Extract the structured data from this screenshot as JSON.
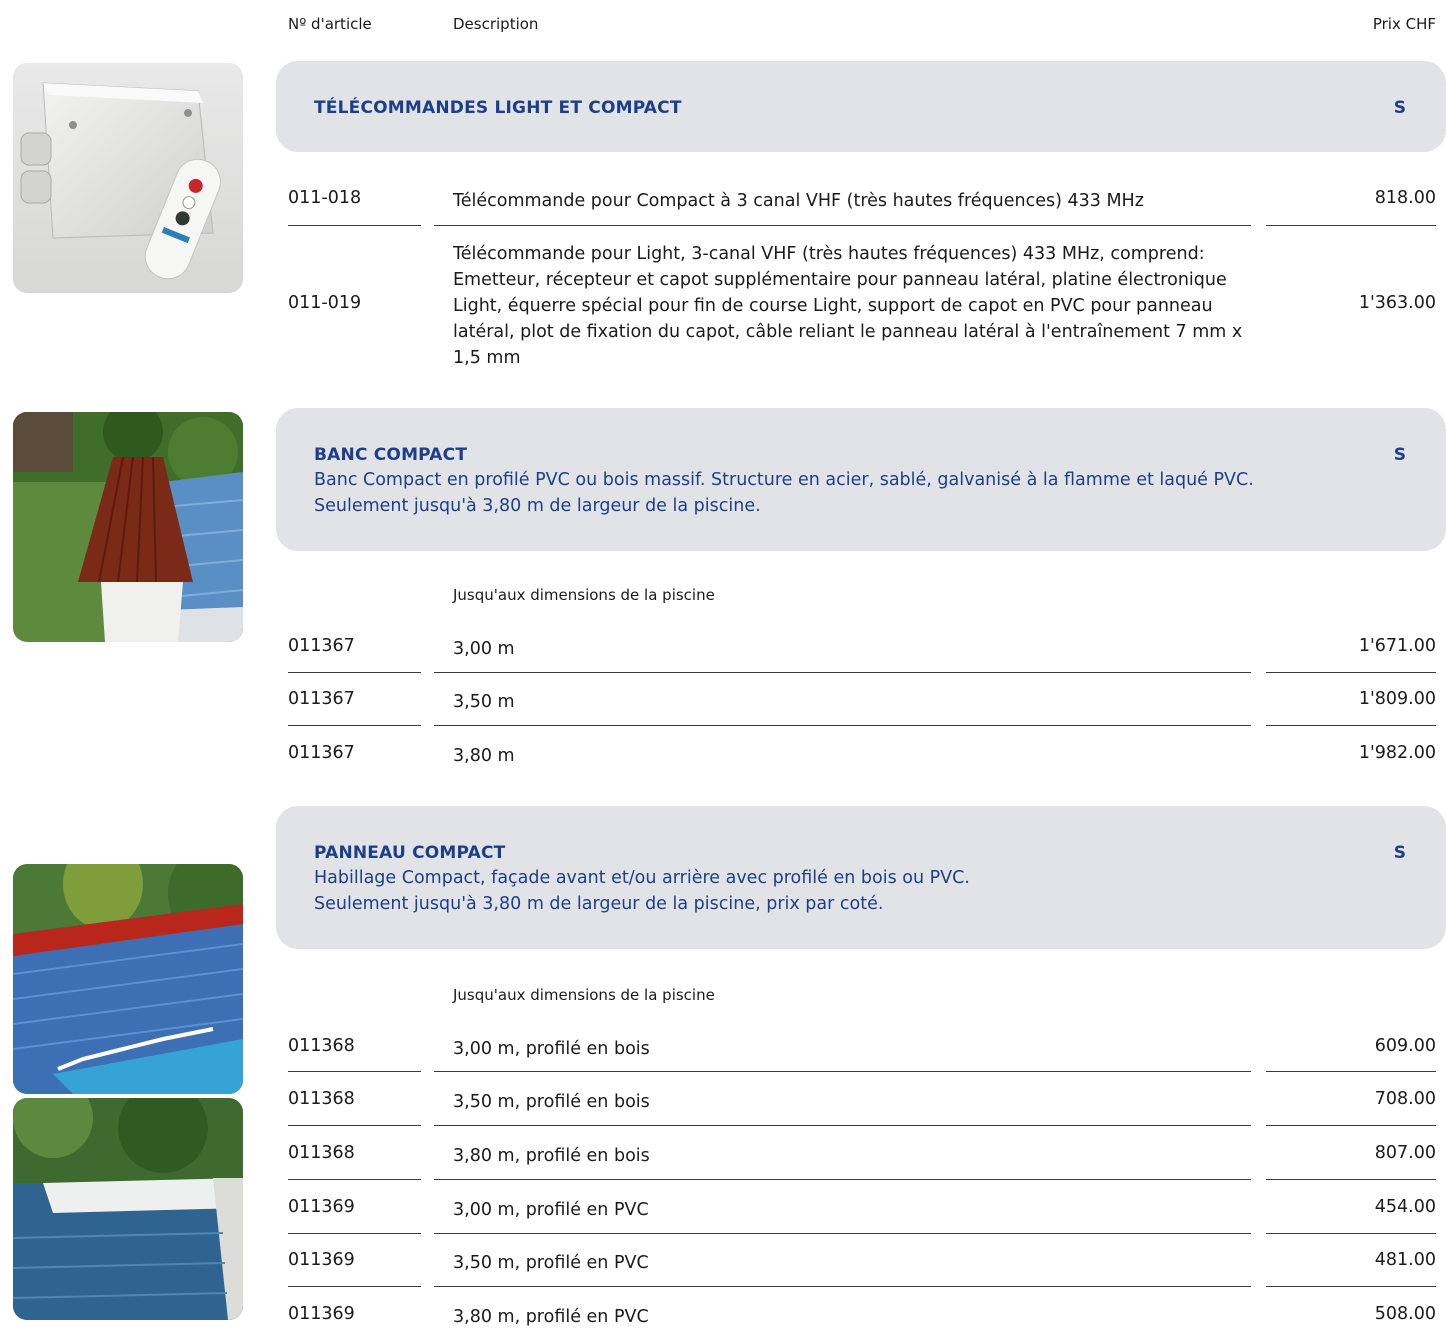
{
  "header": {
    "article": "Nº d'article",
    "description": "Description",
    "price": "Prix CHF"
  },
  "sections": [
    {
      "title": "TÉLÉCOMMANDES LIGHT ET COMPACT",
      "code": "S",
      "rows": [
        {
          "art": "011-018",
          "desc": "Télécommande pour Compact à 3 canal VHF (très hautes fréquences) 433 MHz",
          "price": "818.00"
        },
        {
          "art": "011-019",
          "desc": "Télécommande pour Light, 3-canal VHF (très hautes fréquences) 433 MHz, comprend: Emetteur, récepteur et capot supplémentaire pour panneau latéral, platine électronique Light, équerre spécial pour fin de course Light, support de capot en PVC pour panneau latéral, plot de fixation du capot, câble reliant le panneau latéral à l'entraînement 7 mm x 1,5 mm",
          "price": "1'363.00"
        }
      ]
    },
    {
      "title": "BANC COMPACT",
      "code": "S",
      "desc1": "Banc Compact en profilé PVC ou bois massif. Structure en acier, sablé, galvanisé à la flamme et laqué PVC.",
      "desc2": "Seulement jusqu'à 3,80 m de largeur de la piscine.",
      "subhead": "Jusqu'aux dimensions de la piscine",
      "rows": [
        {
          "art": "011367",
          "desc": "3,00 m",
          "price": "1'671.00"
        },
        {
          "art": "011367",
          "desc": "3,50 m",
          "price": "1'809.00"
        },
        {
          "art": "011367",
          "desc": "3,80 m",
          "price": "1'982.00"
        }
      ]
    },
    {
      "title": "PANNEAU COMPACT",
      "code": "S",
      "desc1": "Habillage Compact, façade avant et/ou arrière avec profilé en bois ou PVC.",
      "desc2": "Seulement jusqu'à 3,80 m de largeur de la piscine, prix par coté.",
      "subhead": "Jusqu'aux dimensions de la piscine",
      "rows": [
        {
          "art": "011368",
          "desc": "3,00 m, profilé en bois",
          "price": "609.00"
        },
        {
          "art": "011368",
          "desc": "3,50 m, profilé en bois",
          "price": "708.00"
        },
        {
          "art": "011368",
          "desc": "3,80 m, profilé en bois",
          "price": "807.00"
        },
        {
          "art": "011369",
          "desc": "3,00 m, profilé en PVC",
          "price": "454.00"
        },
        {
          "art": "011369",
          "desc": "3,50 m, profilé en PVC",
          "price": "481.00"
        },
        {
          "art": "011369",
          "desc": "3,80 m, profilé en PVC",
          "price": "508.00"
        }
      ]
    }
  ]
}
